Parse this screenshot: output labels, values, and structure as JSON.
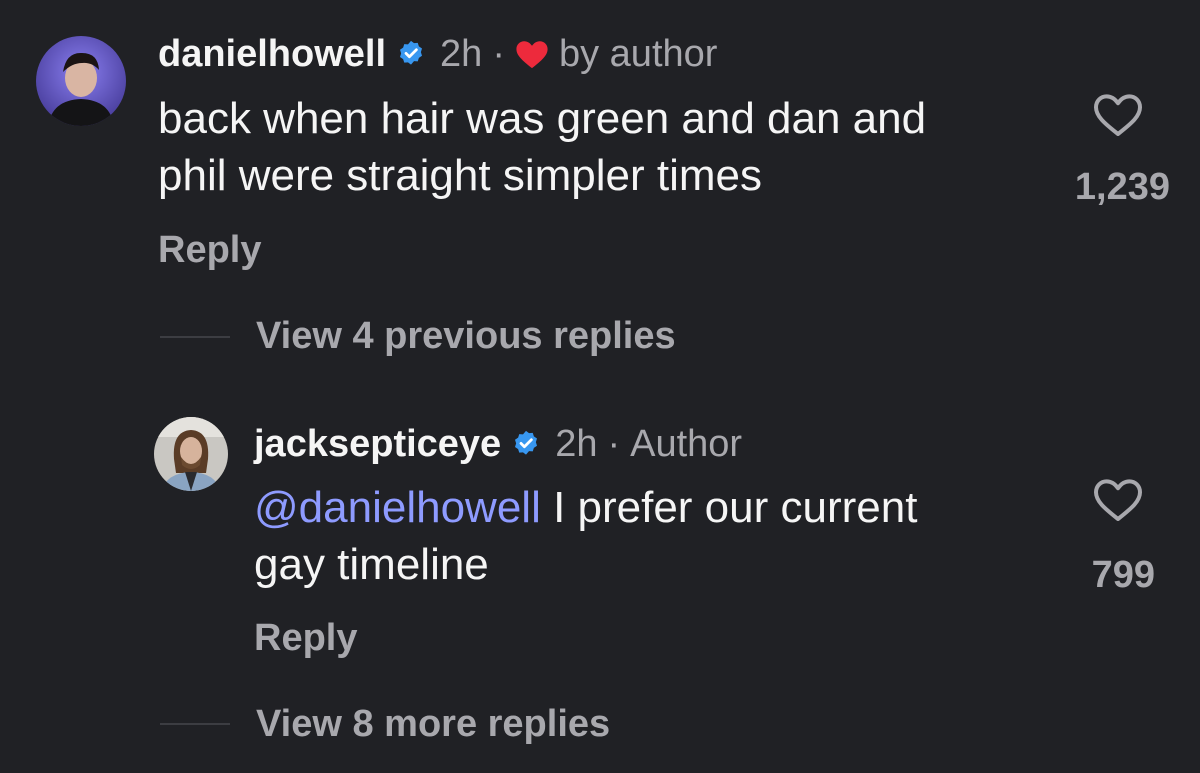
{
  "comment": {
    "username": "danielhowell",
    "time": "2h",
    "separator": "·",
    "by_author_label": "by author",
    "text_line1": "back when hair was green and dan and",
    "text_line2": "phil were straight simpler times",
    "like_count": "1,239",
    "reply_label": "Reply"
  },
  "view_previous_replies_label": "View 4 previous replies",
  "reply": {
    "username": "jacksepticeye",
    "time": "2h",
    "separator": "·",
    "author_label": "Author",
    "mention": "@danielhowell",
    "text_line1": " I prefer our current",
    "text_line2": "gay timeline",
    "like_count": "799",
    "reply_label": "Reply"
  },
  "view_more_replies_label": "View 8 more replies",
  "colors": {
    "background": "#202125",
    "verified": "#3897f0",
    "heart": "#ed2a3c",
    "mention": "#8e9bff",
    "muted_text": "#a8a8ad"
  },
  "icons": {
    "verified": "verified-badge-icon",
    "liked_by_author": "heart-filled-icon",
    "like": "heart-outline-icon"
  }
}
